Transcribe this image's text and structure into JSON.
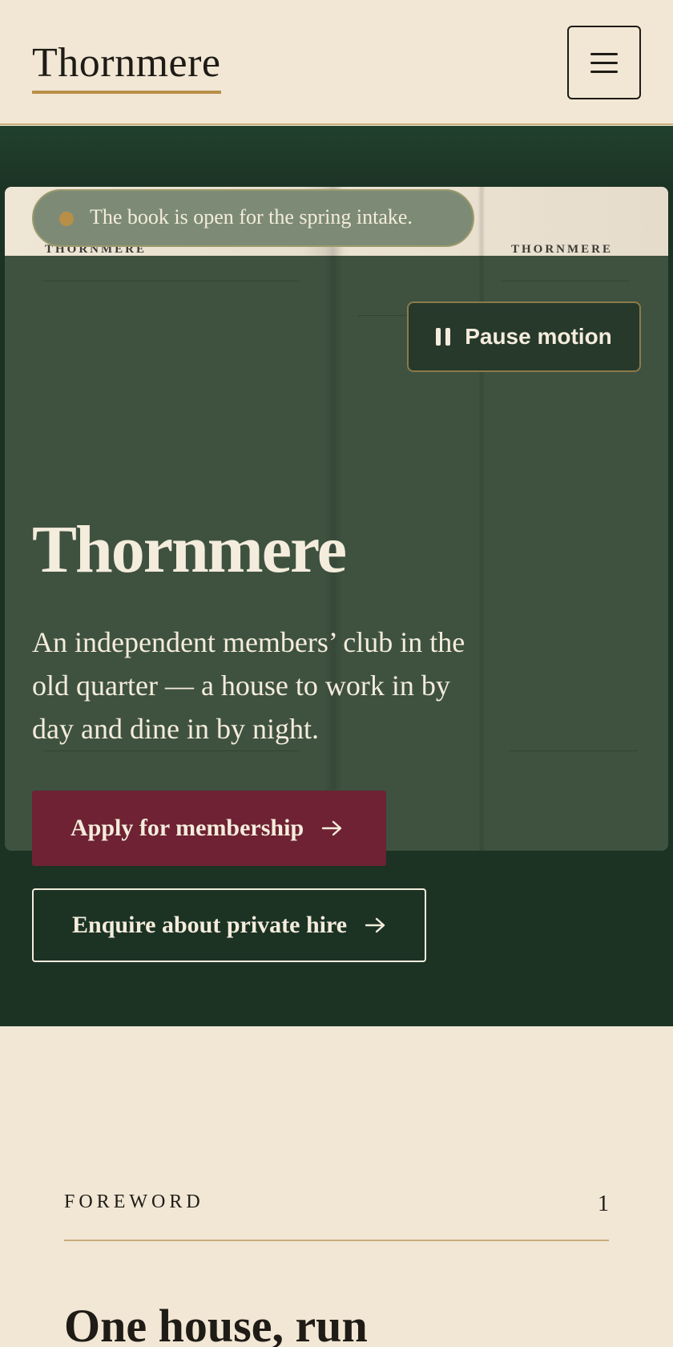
{
  "header": {
    "logo": "Thornmere",
    "menu_icon": "hamburger-menu-icon"
  },
  "hero": {
    "notice": "The book is open for the spring intake.",
    "running_head_left": "THORNMERE",
    "running_head_right": "THORNMERE",
    "pause_label": "Pause motion",
    "title": "Thornmere",
    "lede": "An independent members’ club in the old quarter — a house to work in by day and dine in by night.",
    "primary_cta": "Apply for membership",
    "secondary_cta": "Enquire about private hire"
  },
  "foreword": {
    "eyebrow": "FOREWORD",
    "page_number": "1",
    "heading": "One house, run"
  },
  "colors": {
    "cream": "#f1e7d4",
    "forest": "#1c3324",
    "gold": "#b88f48",
    "claret": "#6e2233"
  }
}
